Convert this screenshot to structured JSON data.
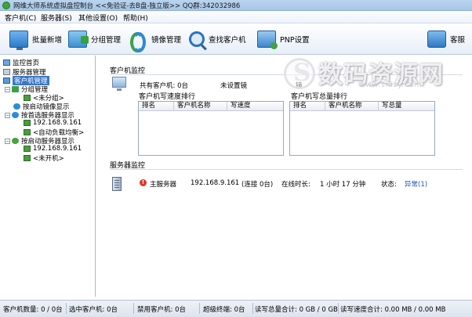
{
  "window": {
    "title": "网维大师系统虚拟盘控制台 <<免验证-去B盘-独立版>> QQ群:342032986"
  },
  "menu": [
    {
      "label": "客户机(C)"
    },
    {
      "label": "服务器(S)"
    },
    {
      "label": "其他设置(O)"
    },
    {
      "label": "帮助(H)"
    }
  ],
  "toolbar": {
    "batch_add": "批量新增",
    "group_manage": "分组管理",
    "image_manage": "镜像管理",
    "find_client": "查找客户机",
    "pnp_settings": "PNP设置",
    "service": "客服"
  },
  "tree": {
    "monitor_home": "监控首页",
    "server_manage": "服务器管理",
    "client_manage": "客户机管理",
    "group_manage": "分组管理",
    "ungrouped": "<未分组>",
    "by_boot_image": "按启动镜像显示",
    "by_preferred_server": "按首选服务器显示",
    "ip1": "192.168.9.161",
    "auto_load_balance": "<自动负载均衡>",
    "by_boot_server": "按启动服务器显示",
    "ip2": "192.168.9.161",
    "not_booted": "<未开机>"
  },
  "client_monitor": {
    "title": "客户机监控",
    "total_clients": "共有客户机: 0台",
    "unset_image": "未设置镜",
    "truncated_label": "镜",
    "write_speed_rank_title": "客户机写速度排行",
    "write_total_rank_title": "客户机写总量排行",
    "speed_columns": [
      "排名",
      "客户机名称",
      "写速度"
    ],
    "total_columns": [
      "排名",
      "客户机名称",
      "写总量"
    ]
  },
  "server_monitor": {
    "title": "服务器监控",
    "name": "主服务器",
    "ip": "192.168.9.161",
    "connections": "(连接 0台)",
    "online_label": "在线时长:",
    "online_duration": "1 小时 17 分钟",
    "status_label": "状态:",
    "status_value": "异常(1)"
  },
  "statusbar": {
    "client_count": "客户机数量: 0 / 0台",
    "selected_clients": "选中客户机: 0台",
    "disabled_clients": "禁用客户机: 0台",
    "super_terminal": "超级终端: 0台",
    "read_write_total": "读写总量合计: 0 GB / 0 GB",
    "read_write_speed": "读写速度合计: 0.00 MB / 0.00 MB"
  },
  "watermark": {
    "text": "数码资源网",
    "url": "www.smzy.com"
  },
  "colors": {
    "accent": "#3a76c5",
    "link": "#1d54b7",
    "warning": "#e0362a"
  }
}
